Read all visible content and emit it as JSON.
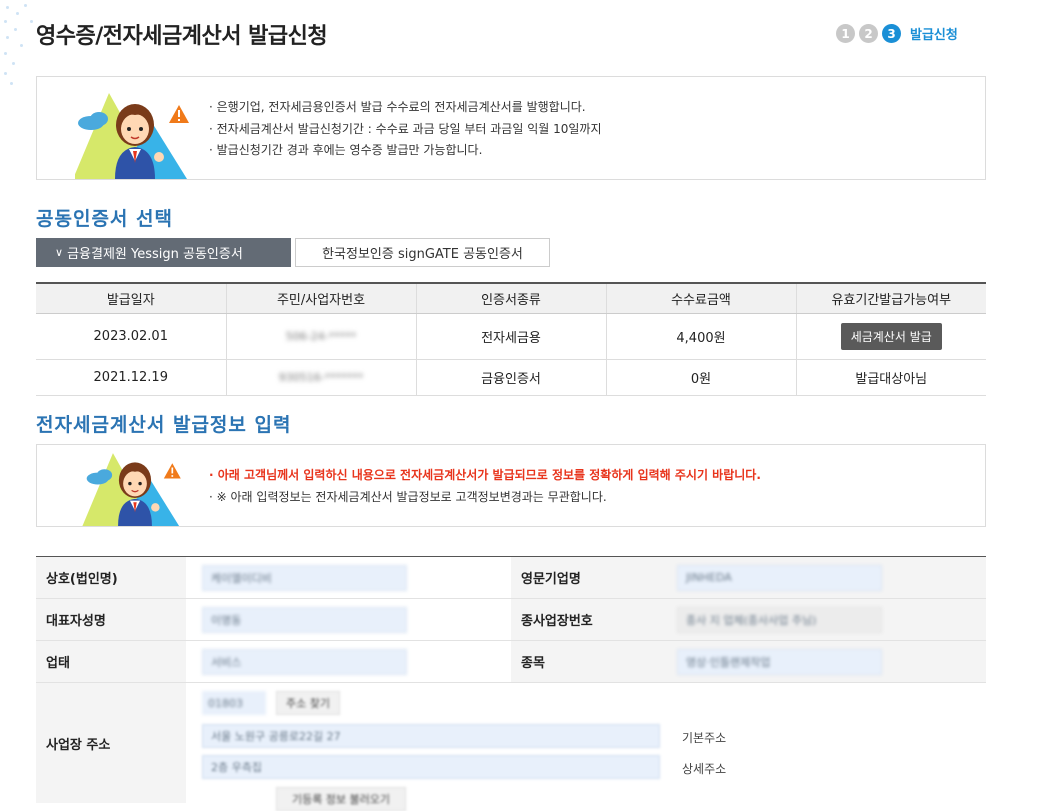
{
  "page_title": "영수증/전자세금계산서 발급신청",
  "steps": {
    "items": [
      "1",
      "2",
      "3"
    ],
    "active_label": "발급신청"
  },
  "notice1": {
    "lines": [
      "은행기업, 전자세금용인증서 발급 수수료의 전자세금계산서를 발행합니다.",
      "전자세금계산서 발급신청기간 : 수수료 과금 당일 부터 과금일 익월 10일까지",
      "발급신청기간 경과 후에는 영수증 발급만 가능합니다."
    ]
  },
  "cert_section": {
    "title": "공동인증서 선택",
    "tabs": [
      "금융결제원 Yessign 공동인증서",
      "한국정보인증 signGATE 공동인증서"
    ],
    "columns": [
      "발급일자",
      "주민/사업자번호",
      "인증서종류",
      "수수료금액",
      "유효기간발급가능여부"
    ],
    "rows": [
      {
        "date": "2023.02.01",
        "id_no": "506-24-*****",
        "type": "전자세금용",
        "fee": "4,400원",
        "status": "세금계산서 발급"
      },
      {
        "date": "2021.12.19",
        "id_no": "930516-*******",
        "type": "금융인증서",
        "fee": "0원",
        "status": "발급대상아님"
      }
    ]
  },
  "issue_section": {
    "title": "전자세금계산서 발급정보 입력"
  },
  "notice2": {
    "lines": [
      "아래 고객님께서 입력하신 내용으로 전자세금계산서가 발급되므로 정보를 정확하게 입력해 주시기 바랍니다.",
      "※ 아래 입력정보는 전자세금계산서 발급정보로 고객정보변경과는 무관합니다."
    ]
  },
  "form": {
    "company_label": "상호(법인명)",
    "company_value": "케이엘이디비",
    "eng_name_label": "영문기업명",
    "eng_name_value": "JINHEDA",
    "ceo_label": "대표자성명",
    "ceo_value": "이명동",
    "branch_label": "종사업장번호",
    "branch_value": "종사 지 업체(종사사업 주님)",
    "biz_type_label": "업태",
    "biz_type_value": "서비스",
    "biz_item_label": "종목",
    "biz_item_value": "영상·인틀랜제작업",
    "address_label": "사업장 주소",
    "zip_value": "01803",
    "zip_button": "주소 찾기",
    "address_basic": "서울 노원구 공릉로22길 27",
    "address_basic_hint": "기본주소",
    "address_detail": "2층 우측집",
    "address_detail_hint": "상세주소",
    "address_button": "기등록 정보 불러오기"
  },
  "colors": {
    "accent": "#1a8fd6",
    "section_title": "#2b74b3",
    "warning": "#e8341c",
    "tab_active": "#636b75"
  }
}
